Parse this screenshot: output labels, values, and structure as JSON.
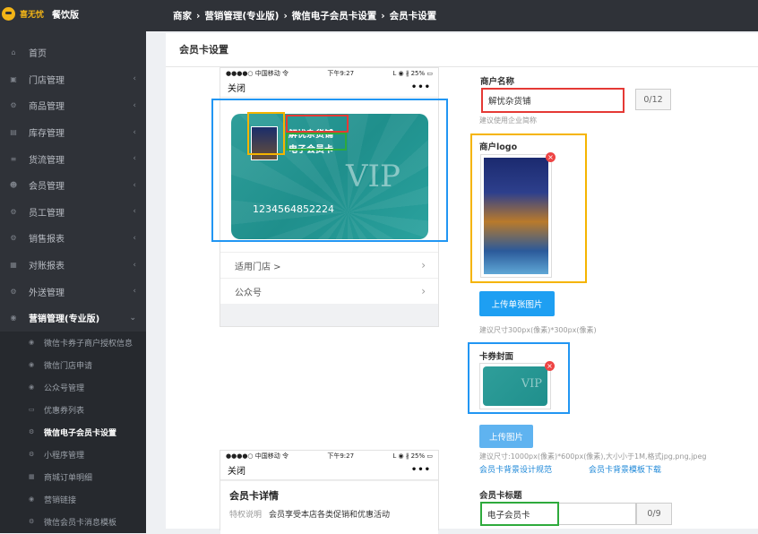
{
  "app": {
    "brand_main": "喜无忧",
    "brand_sub": "餐饮版"
  },
  "sidebar": {
    "items": [
      {
        "label": "首页",
        "icon": "home-icon",
        "glyph": "⌂",
        "has_arrow": false
      },
      {
        "label": "门店管理",
        "icon": "cart-icon",
        "glyph": "▣",
        "has_arrow": true
      },
      {
        "label": "商品管理",
        "icon": "gears-icon",
        "glyph": "⚙",
        "has_arrow": true
      },
      {
        "label": "库存管理",
        "icon": "box-icon",
        "glyph": "▤",
        "has_arrow": true
      },
      {
        "label": "货流管理",
        "icon": "list-icon",
        "glyph": "≡",
        "has_arrow": true
      },
      {
        "label": "会员管理",
        "icon": "users-icon",
        "glyph": "☻",
        "has_arrow": true
      },
      {
        "label": "员工管理",
        "icon": "gears-icon",
        "glyph": "⚙",
        "has_arrow": true
      },
      {
        "label": "销售报表",
        "icon": "gears-icon",
        "glyph": "⚙",
        "has_arrow": true
      },
      {
        "label": "对账报表",
        "icon": "table-icon",
        "glyph": "▦",
        "has_arrow": true
      },
      {
        "label": "外送管理",
        "icon": "gears-icon",
        "glyph": "⚙",
        "has_arrow": true
      },
      {
        "label": "营销管理(专业版)",
        "icon": "wechat-icon",
        "glyph": "◉",
        "has_arrow": true,
        "open": true
      }
    ],
    "sub_items": [
      {
        "label": "微信卡券子商户授权信息",
        "icon": "wechat-icon",
        "glyph": "◉"
      },
      {
        "label": "微信门店申请",
        "icon": "wechat-icon",
        "glyph": "◉"
      },
      {
        "label": "公众号管理",
        "icon": "wechat-icon",
        "glyph": "◉"
      },
      {
        "label": "优惠券列表",
        "icon": "card-icon",
        "glyph": "▭"
      },
      {
        "label": "微信电子会员卡设置",
        "icon": "gears-icon",
        "glyph": "⚙",
        "active": true
      },
      {
        "label": "小程序管理",
        "icon": "gears-icon",
        "glyph": "⚙"
      },
      {
        "label": "商城订单明细",
        "icon": "table-icon",
        "glyph": "▦"
      },
      {
        "label": "营销链接",
        "icon": "wechat-icon",
        "glyph": "◉"
      },
      {
        "label": "微信会员卡消息模板",
        "icon": "gears-icon",
        "glyph": "⚙"
      }
    ]
  },
  "breadcrumb": {
    "items": [
      "商家",
      "营销管理(专业版)",
      "微信电子会员卡设置",
      "会员卡设置"
    ],
    "separator": "›"
  },
  "main": {
    "title": "会员卡设置"
  },
  "phone1": {
    "status_left": "●●●●○ 中国移动 令",
    "status_time": "下午9:27",
    "status_right": "ᒪ ◉ ∦ 25% ▭",
    "close_label": "关闭",
    "menu_dots": "•••",
    "card": {
      "merchant_name": "解忧杂货铺",
      "card_title": "电子会员卡",
      "vip_text": "VIP",
      "card_number": "1234564852224"
    },
    "rows": [
      {
        "label": "适用门店 >",
        "chevron": "›"
      },
      {
        "label": "公众号",
        "chevron": "›"
      }
    ]
  },
  "phone2": {
    "status_left": "●●●●○ 中国移动 令",
    "status_time": "下午9:27",
    "status_right": "ᒪ ◉ ∦ 25% ▭",
    "close_label": "关闭",
    "menu_dots": "•••",
    "detail_title": "会员卡详情",
    "privilege_label": "特权说明",
    "privilege_text": "会员享受本店各类促销和优惠活动"
  },
  "form": {
    "merchant_name_label": "商户名称",
    "merchant_name_value": "解忧杂货铺",
    "merchant_name_count": "0/12",
    "merchant_name_hint": "建议使用企业简称",
    "logo_label": "商户logo",
    "upload_single_label": "上传单张图片",
    "logo_size_hint": "建议尺寸300px(像素)*300px(像素)",
    "cover_label": "卡券封面",
    "cover_vip_text": "VIP",
    "upload_image_label": "上传图片",
    "cover_size_hint": "建议尺寸:1000px(像素)*600px(像素),大小小于1M,格式jpg,png,jpeg",
    "bg_design_link": "会员卡背景设计规范",
    "bg_template_link": "会员卡背景模板下载",
    "card_title_label": "会员卡标题",
    "card_title_value": "电子会员卡",
    "card_title_count": "0/9",
    "delete_glyph": "×"
  },
  "colors": {
    "sidebar_bg": "#2f3238",
    "highlight_blue": "#2196f3",
    "highlight_red": "#e53935",
    "highlight_yellow": "#f5b400",
    "highlight_green": "#2eaa3c",
    "card_teal": "#2a9a96",
    "button_blue": "#1e9ff2"
  }
}
